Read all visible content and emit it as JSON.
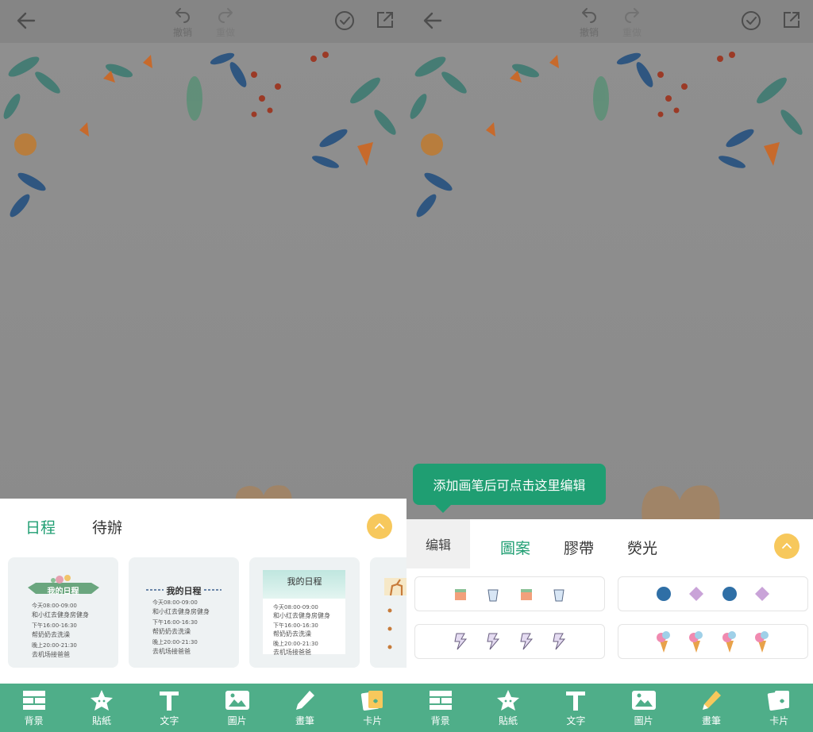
{
  "toolbar": {
    "undo_label": "撤销",
    "redo_label": "重做"
  },
  "left": {
    "tabs": [
      "日程",
      "待辦"
    ],
    "cards": [
      {
        "title": "我的日程",
        "lines": [
          "今天08:00-09:00",
          "和小红去健身房健身",
          "下午16:00-16:30",
          "帮奶奶去洗澡",
          "晚上20:00-21:30",
          "去机场接爸爸"
        ]
      },
      {
        "title": "我的日程",
        "lines": [
          "今天08:00-09:00",
          "和小红去健身房健身",
          "下午16:00-16:30",
          "帮奶奶去洗澡",
          "晚上20:00-21:30",
          "去机场接爸爸"
        ]
      },
      {
        "title": "我的日程",
        "lines": [
          "今天08:00-09:00",
          "和小红去健身房健身",
          "下午16:00-16:30",
          "帮奶奶去洗澡",
          "晚上20:00-21:30",
          "去机场接爸爸"
        ]
      }
    ]
  },
  "right": {
    "tooltip": "添加画笔后可点击这里编辑",
    "edit_tab": "编辑",
    "tabs": [
      "圖案",
      "膠帶",
      "熒光"
    ]
  },
  "nav": [
    "背景",
    "貼紙",
    "文字",
    "圖片",
    "畫筆",
    "卡片"
  ],
  "colors": {
    "accent": "#1f9e72",
    "nav_bg": "#4fae89",
    "collapse": "#f7c85c"
  }
}
